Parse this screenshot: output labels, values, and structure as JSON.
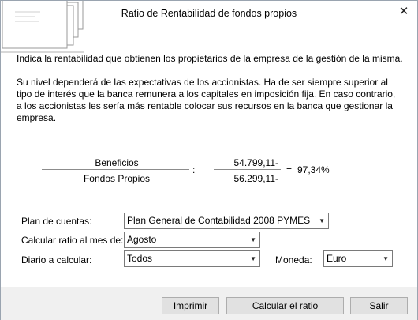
{
  "window": {
    "title": "Ratio de Rentabilidad de fondos propios",
    "close_icon": "close-icon"
  },
  "intro": {
    "line1": "Indica la rentabilidad que obtienen los propietarios de la empresa de la gestión de la misma.",
    "line2": "Su nivel dependerá de las expectativas de los accionistas. Ha de ser siempre superior al tipo de interés que la banca remunera a los capitales en imposición fija. En caso contrario, a los accionistas les sería  más rentable colocar sus recursos en la banca que gestionar la empresa."
  },
  "formula": {
    "numerator_label": "Beneficios",
    "denominator_label": "Fondos Propios",
    "colon": ":",
    "numerator_value": "54.799,11-",
    "denominator_value": "56.299,11-",
    "equals": "=",
    "result": "97,34%"
  },
  "form": {
    "plan_label": "Plan de cuentas:",
    "plan_value": "Plan General de Contabilidad 2008 PYMES",
    "mes_label": "Calcular ratio al mes de:",
    "mes_value": "Agosto",
    "diario_label": "Diario a calcular:",
    "diario_value": "Todos",
    "moneda_label": "Moneda:",
    "moneda_value": "Euro"
  },
  "buttons": {
    "print": "Imprimir",
    "calculate": "Calcular el ratio",
    "exit": "Salir"
  }
}
